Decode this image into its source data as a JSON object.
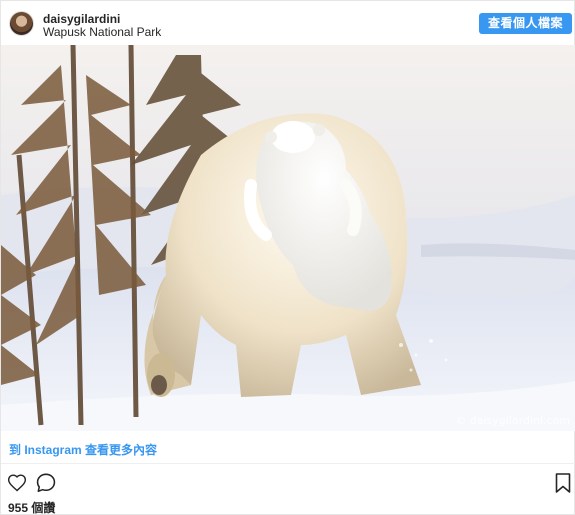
{
  "header": {
    "username": "daisygilardini",
    "location": "Wapusk National Park",
    "follow_label": "查看個人檔案"
  },
  "photo": {
    "watermark": "© daisygilardini.com"
  },
  "more_link": "到 Instagram 查看更多內容",
  "actions": {
    "like_icon": "heart-icon",
    "comment_icon": "comment-icon",
    "save_icon": "bookmark-icon"
  },
  "likes": "955 個讚",
  "colors": {
    "accent": "#3897f0",
    "text": "#262626",
    "divider": "#efefef"
  }
}
